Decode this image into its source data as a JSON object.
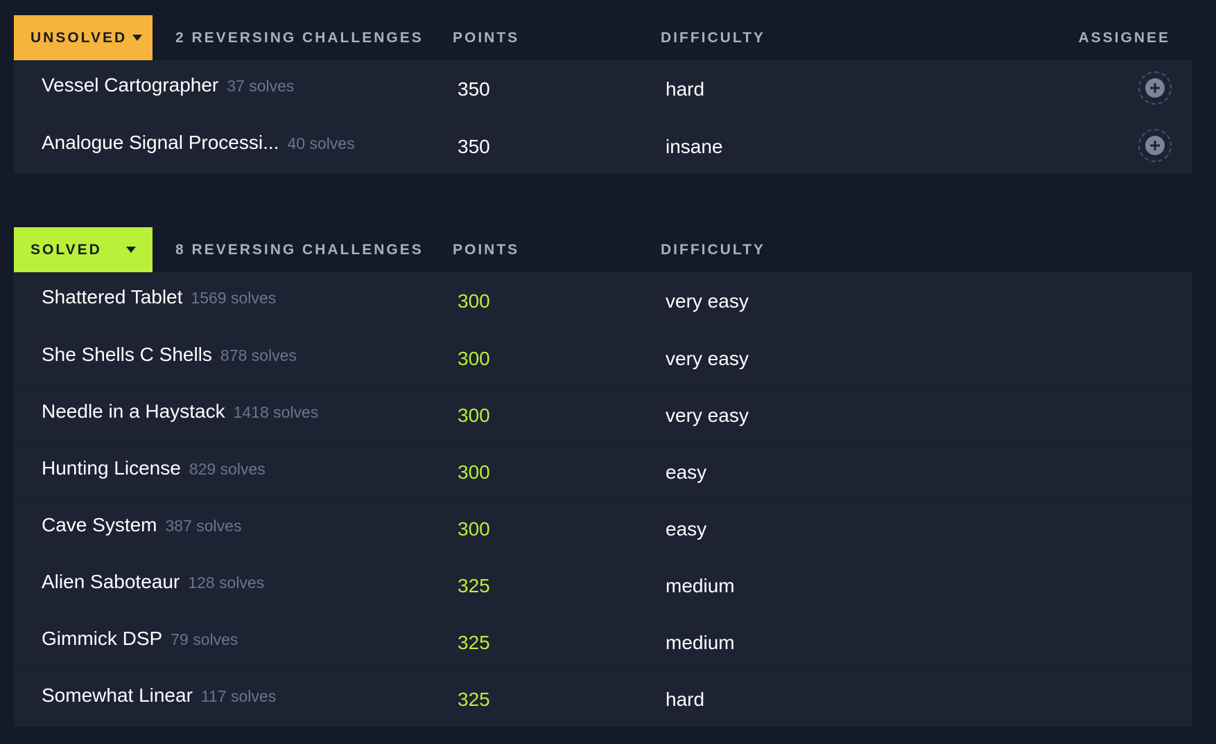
{
  "unsolved": {
    "status_label": "UNSOLVED",
    "header_title": "2 REVERSING CHALLENGES",
    "header_points": "POINTS",
    "header_difficulty": "DIFFICULTY",
    "header_assignee": "ASSIGNEE",
    "rows": [
      {
        "name": "Vessel Cartographer",
        "solves": "37 solves",
        "points": "350",
        "difficulty": "hard"
      },
      {
        "name": "Analogue Signal Processi...",
        "solves": "40 solves",
        "points": "350",
        "difficulty": "insane"
      }
    ]
  },
  "solved": {
    "status_label": "SOLVED",
    "header_title": "8 REVERSING CHALLENGES",
    "header_points": "POINTS",
    "header_difficulty": "DIFFICULTY",
    "rows": [
      {
        "name": "Shattered Tablet",
        "solves": "1569 solves",
        "points": "300",
        "difficulty": "very easy"
      },
      {
        "name": "She Shells C Shells",
        "solves": "878 solves",
        "points": "300",
        "difficulty": "very easy"
      },
      {
        "name": "Needle in a Haystack",
        "solves": "1418 solves",
        "points": "300",
        "difficulty": "very easy"
      },
      {
        "name": "Hunting License",
        "solves": "829 solves",
        "points": "300",
        "difficulty": "easy"
      },
      {
        "name": "Cave System",
        "solves": "387 solves",
        "points": "300",
        "difficulty": "easy"
      },
      {
        "name": "Alien Saboteaur",
        "solves": "128 solves",
        "points": "325",
        "difficulty": "medium"
      },
      {
        "name": "Gimmick DSP",
        "solves": "79 solves",
        "points": "325",
        "difficulty": "medium"
      },
      {
        "name": "Somewhat Linear",
        "solves": "117 solves",
        "points": "325",
        "difficulty": "hard"
      }
    ]
  },
  "colors": {
    "background": "#141a28",
    "row_background": "#1d2333",
    "unsolved_accent": "#f6b43c",
    "solved_accent": "#b8f03a",
    "muted_text": "#6c7589",
    "header_text": "#a7b0c2"
  },
  "icons": {
    "status_dropdown": "chevron-down-icon",
    "assign": "plus-circle-icon"
  }
}
